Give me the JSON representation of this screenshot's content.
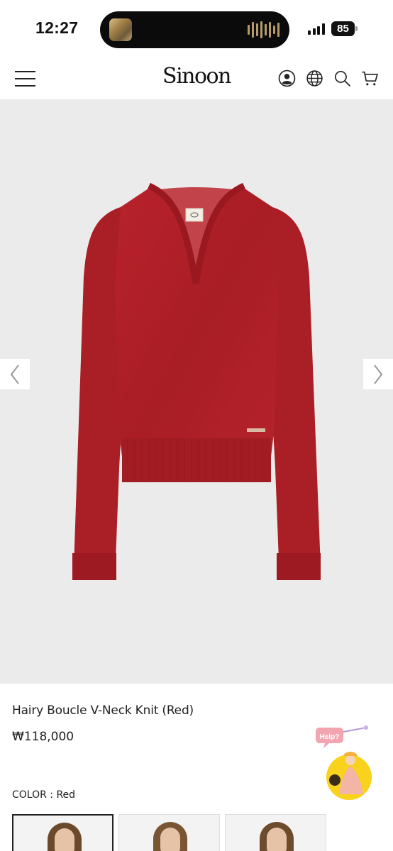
{
  "status_bar": {
    "time": "12:27",
    "battery": "85"
  },
  "header": {
    "logo": "Sinoon",
    "icons": [
      "menu-icon",
      "account-icon",
      "globe-icon",
      "search-icon",
      "cart-icon"
    ]
  },
  "product": {
    "title": "Hairy Boucle V-Neck Knit (Red)",
    "price": "₩118,000",
    "color_label": "COLOR : Red",
    "image_color": "#b01e27",
    "background_color": "#ebebeb",
    "help_label": "Help?"
  },
  "gallery": {
    "prev_icon": "chevron-left-icon",
    "next_icon": "chevron-right-icon"
  }
}
